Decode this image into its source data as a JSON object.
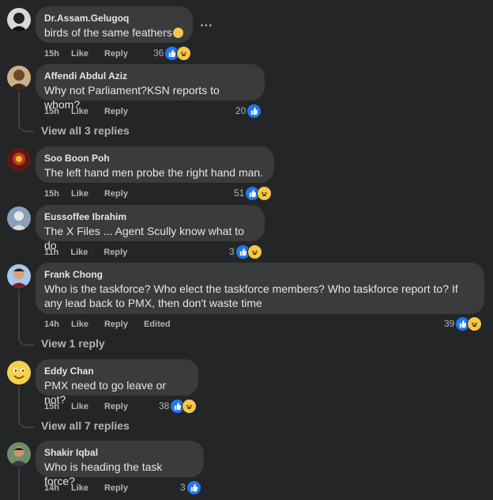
{
  "actions": {
    "like": "Like",
    "reply": "Reply",
    "edited": "Edited"
  },
  "comments": [
    {
      "author": "Dr.Assam.Gelugoq",
      "text": "birds of the same feathers",
      "time": "15h",
      "reactions": "36"
    },
    {
      "author": "Affendi Abdul Aziz",
      "text": "Why not Parliament?KSN reports to whom?",
      "time": "15h",
      "reactions": "20",
      "replies": "View all 3 replies"
    },
    {
      "author": "Soo Boon Poh",
      "text": "The left hand men probe the right hand man.",
      "time": "15h",
      "reactions": "51"
    },
    {
      "author": "Eussoffee Ibrahim",
      "text": "The X Files ... Agent Scully know what to do",
      "time": "11h",
      "reactions": "3"
    },
    {
      "author": "Frank Chong",
      "text_line1": "Who is the taskforce? Who elect the taskforce members? Who taskforce report to? If",
      "text_line2": "any lead back to PMX, then don't waste time",
      "time": "14h",
      "reactions": "39",
      "replies": "View 1 reply"
    },
    {
      "author": "Eddy Chan",
      "text": "PMX need to go leave or not?",
      "time": "15h",
      "reactions": "38",
      "replies": "View all 7 replies"
    },
    {
      "author": "Shakir Iqbal",
      "text": "Who is heading the task force?",
      "time": "14h",
      "reactions": "3"
    }
  ],
  "more_options": "⋯",
  "colors": {
    "background": "#242526",
    "bubble": "#3a3b3c",
    "like": "#2078f4",
    "haha": "#f7c74d"
  }
}
